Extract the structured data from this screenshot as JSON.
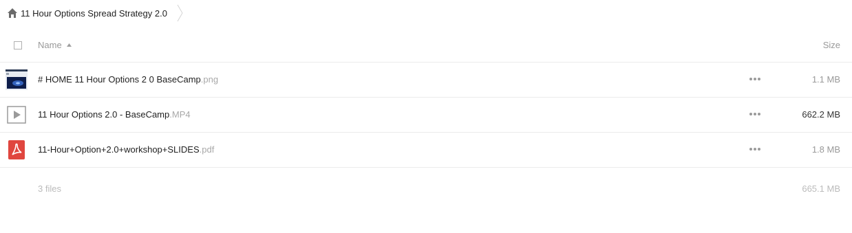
{
  "breadcrumb": {
    "home_icon": "home-icon",
    "title": "11 Hour Options Spread Strategy 2.0"
  },
  "header": {
    "name_label": "Name",
    "size_label": "Size",
    "sort": "ascending"
  },
  "files": [
    {
      "base": "# HOME 11 Hour Options 2 0 BaseCamp",
      "ext": ".png",
      "size": "1.1 MB",
      "icon": "image-thumbnail"
    },
    {
      "base": "11 Hour Options 2.0 - BaseCamp",
      "ext": ".MP4",
      "size": "662.2 MB",
      "icon": "video-play-icon"
    },
    {
      "base": "11-Hour+Option+2.0+workshop+SLIDES",
      "ext": ".pdf",
      "size": "1.8 MB",
      "icon": "pdf-icon"
    }
  ],
  "summary": {
    "count": "3 files",
    "total_size": "665.1 MB"
  },
  "colors": {
    "pdf_red": "#e0463f",
    "muted_text": "#999999",
    "border": "#ebebeb"
  }
}
